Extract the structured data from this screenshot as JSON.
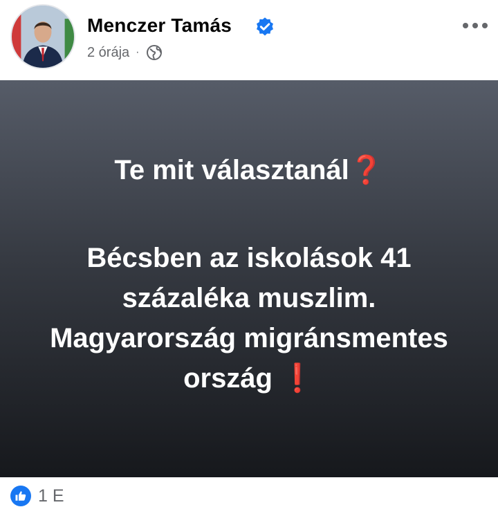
{
  "post": {
    "author": "Menczer Tamás",
    "time": "2 órája",
    "separator": "·",
    "visibility_icon": "globe-icon",
    "verified_icon": "verified-badge-icon",
    "more_icon": "more-options-icon",
    "headline": "Te mit választanál",
    "body_line1": "Bécsben az iskolások 41",
    "body_line2": "százaléka muszlim.",
    "body_line3": "Magyarország migránsmentes",
    "body_line4": "ország",
    "question_mark": "❓",
    "exclamation_mark": "❗",
    "reaction_icon": "like-icon",
    "reaction_count": "1 E"
  },
  "colors": {
    "accent": "#1877f2",
    "text_primary": "#050505",
    "text_secondary": "#65676b",
    "card_gradient_top": "#565c68",
    "card_gradient_bottom": "#16181c"
  }
}
